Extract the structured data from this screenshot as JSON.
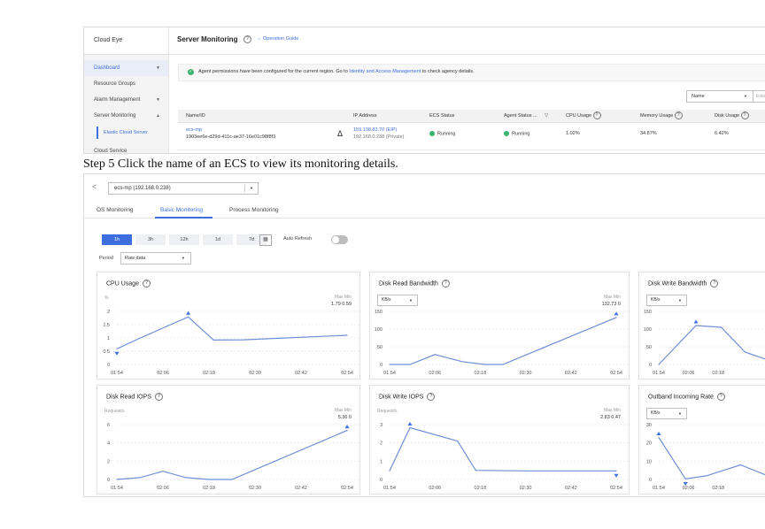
{
  "top": {
    "sidebar": {
      "title": "Cloud Eye",
      "items": [
        {
          "label": "Dashboard",
          "caret": "▼"
        },
        {
          "label": "Resource Groups",
          "caret": ""
        },
        {
          "label": "Alarm Management",
          "caret": "▼"
        },
        {
          "label": "Server Monitoring",
          "caret": "▲"
        }
      ],
      "sub_item": "Elastic Cloud Server",
      "cut_item": "Cloud Service"
    },
    "header": {
      "title": "Server Monitoring",
      "help": "?",
      "guide": "Operation Guide"
    },
    "banner": {
      "icon": "check-circle-icon",
      "text_before": "Agent permissions have been configured for the current region. Go to ",
      "link": "Identity and Access Management",
      "text_after": " to check agency details."
    },
    "filter": {
      "select_value": "Name",
      "input_placeholder": "Ente"
    },
    "table": {
      "headers": [
        "Name/ID",
        "IP Address",
        "ECS Status",
        "Agent Status ...",
        "CPU Usage",
        "Memory Usage",
        "Disk Usage"
      ],
      "row": {
        "name": "ecs-mp",
        "id": "1903ee6e-d29d-411c-ae37-16e01c98f8f3",
        "warning": "Δ",
        "ip_eip": "159.138.83.70 (EIP)",
        "ip_private": "192.168.0.238 (Private)",
        "ecs_status": "Running",
        "agent_status": "Running",
        "cpu": "1.02%",
        "memory": "34.87%",
        "disk": "6.42%"
      }
    }
  },
  "caption": "Step 5 Click the name of an ECS to view its monitoring details.",
  "bottom": {
    "back": "<",
    "host_select": "ecs-mp (192.168.0.238)",
    "tabs": [
      "OS Monitoring",
      "Basic Monitoring",
      "Process Monitoring"
    ],
    "active_tab": "Basic Monitoring",
    "periods": [
      "1h",
      "3h",
      "12h",
      "1d",
      "7d"
    ],
    "active_period": "1h",
    "calendar_icon": "calendar-icon",
    "auto_refresh": "Auto Refresh",
    "period_label": "Period",
    "period_value": "Raw data",
    "max_label": "Max",
    "min_label": "Min"
  },
  "chart_data": [
    {
      "type": "line",
      "title": "CPU Usage",
      "unit": "%",
      "x_ticks": [
        "01:54",
        "02:06",
        "02:18",
        "02:30",
        "02:42",
        "02:54"
      ],
      "y_ticks": [
        "2",
        "1.5",
        "1",
        "0.5",
        "0"
      ],
      "ylim": [
        0,
        2
      ],
      "max": "1.79",
      "min": "0.59",
      "x": [
        0,
        0.09,
        0.22,
        0.31,
        0.42,
        1
      ],
      "y": [
        0.6,
        0.95,
        1.45,
        1.79,
        0.92,
        0.94,
        1.1
      ],
      "points": [
        [
          0,
          0.59
        ],
        [
          0.09,
          0.95
        ],
        [
          0.22,
          1.45
        ],
        [
          0.31,
          1.79
        ],
        [
          0.42,
          0.92
        ],
        [
          0.55,
          0.93
        ],
        [
          1,
          1.1
        ]
      ],
      "max_at": 0.31,
      "min_at": 0
    },
    {
      "type": "line",
      "title": "Disk Read Bandwidth",
      "unit": "KB/s",
      "x_ticks": [
        "01:54",
        "02:06",
        "02:18",
        "02:30",
        "02:42",
        "02:54"
      ],
      "y_ticks": [
        "150",
        "100",
        "50",
        "0"
      ],
      "ylim": [
        0,
        150
      ],
      "max": "132.73",
      "min": "0",
      "points": [
        [
          0,
          0
        ],
        [
          0.09,
          0
        ],
        [
          0.2,
          28
        ],
        [
          0.32,
          8
        ],
        [
          0.42,
          0
        ],
        [
          0.5,
          0
        ],
        [
          1,
          132.73
        ]
      ],
      "max_at": 1,
      "min_at": null
    },
    {
      "type": "line",
      "title": "Disk Write Bandwidth",
      "unit": "KB/s",
      "x_ticks": [
        "01:54",
        "02:06",
        "02:18"
      ],
      "y_ticks": [
        "150",
        "100",
        "50",
        "0"
      ],
      "ylim": [
        0,
        150
      ],
      "points": [
        [
          0,
          0
        ],
        [
          0.25,
          110
        ],
        [
          0.42,
          105
        ],
        [
          0.58,
          35
        ],
        [
          0.8,
          3
        ],
        [
          1,
          3
        ]
      ],
      "max_at": 0.25,
      "min_at": 1
    },
    {
      "type": "line",
      "title": "Disk Read IOPS",
      "unit": "Request/s",
      "x_ticks": [
        "01:54",
        "02:06",
        "02:18",
        "02:30",
        "02:42",
        "02:54"
      ],
      "y_ticks": [
        "6",
        "4",
        "2",
        "0"
      ],
      "ylim": [
        0,
        6
      ],
      "max": "5.36",
      "min": "0",
      "points": [
        [
          0,
          0
        ],
        [
          0.1,
          0.2
        ],
        [
          0.2,
          0.9
        ],
        [
          0.3,
          0.2
        ],
        [
          0.4,
          0
        ],
        [
          0.5,
          0
        ],
        [
          1,
          5.36
        ]
      ],
      "max_at": 1,
      "min_at": null
    },
    {
      "type": "line",
      "title": "Disk Write IOPS",
      "unit": "Request/s",
      "x_ticks": [
        "01:54",
        "02:06",
        "02:18",
        "02:30",
        "02:42",
        "02:54"
      ],
      "y_ticks": [
        "3",
        "2",
        "1",
        "0"
      ],
      "ylim": [
        0,
        3
      ],
      "max": "2.83",
      "min": "0.47",
      "points": [
        [
          0,
          0.47
        ],
        [
          0.09,
          2.83
        ],
        [
          0.3,
          2.1
        ],
        [
          0.38,
          0.5
        ],
        [
          0.6,
          0.47
        ],
        [
          1,
          0.47
        ]
      ],
      "max_at": 0.09,
      "min_at": 1
    },
    {
      "type": "line",
      "title": "Outband Incoming Rate",
      "unit": "KB/s",
      "x_ticks": [
        "01:54",
        "02:06",
        "02:18"
      ],
      "y_ticks": [
        "30",
        "20",
        "10",
        "0"
      ],
      "ylim": [
        0,
        30
      ],
      "points": [
        [
          0,
          23
        ],
        [
          0.18,
          0.3
        ],
        [
          0.32,
          2
        ],
        [
          0.55,
          8
        ],
        [
          0.78,
          0.5
        ],
        [
          1,
          0.5
        ]
      ],
      "max_at": 0,
      "min_at": 0.18
    }
  ]
}
